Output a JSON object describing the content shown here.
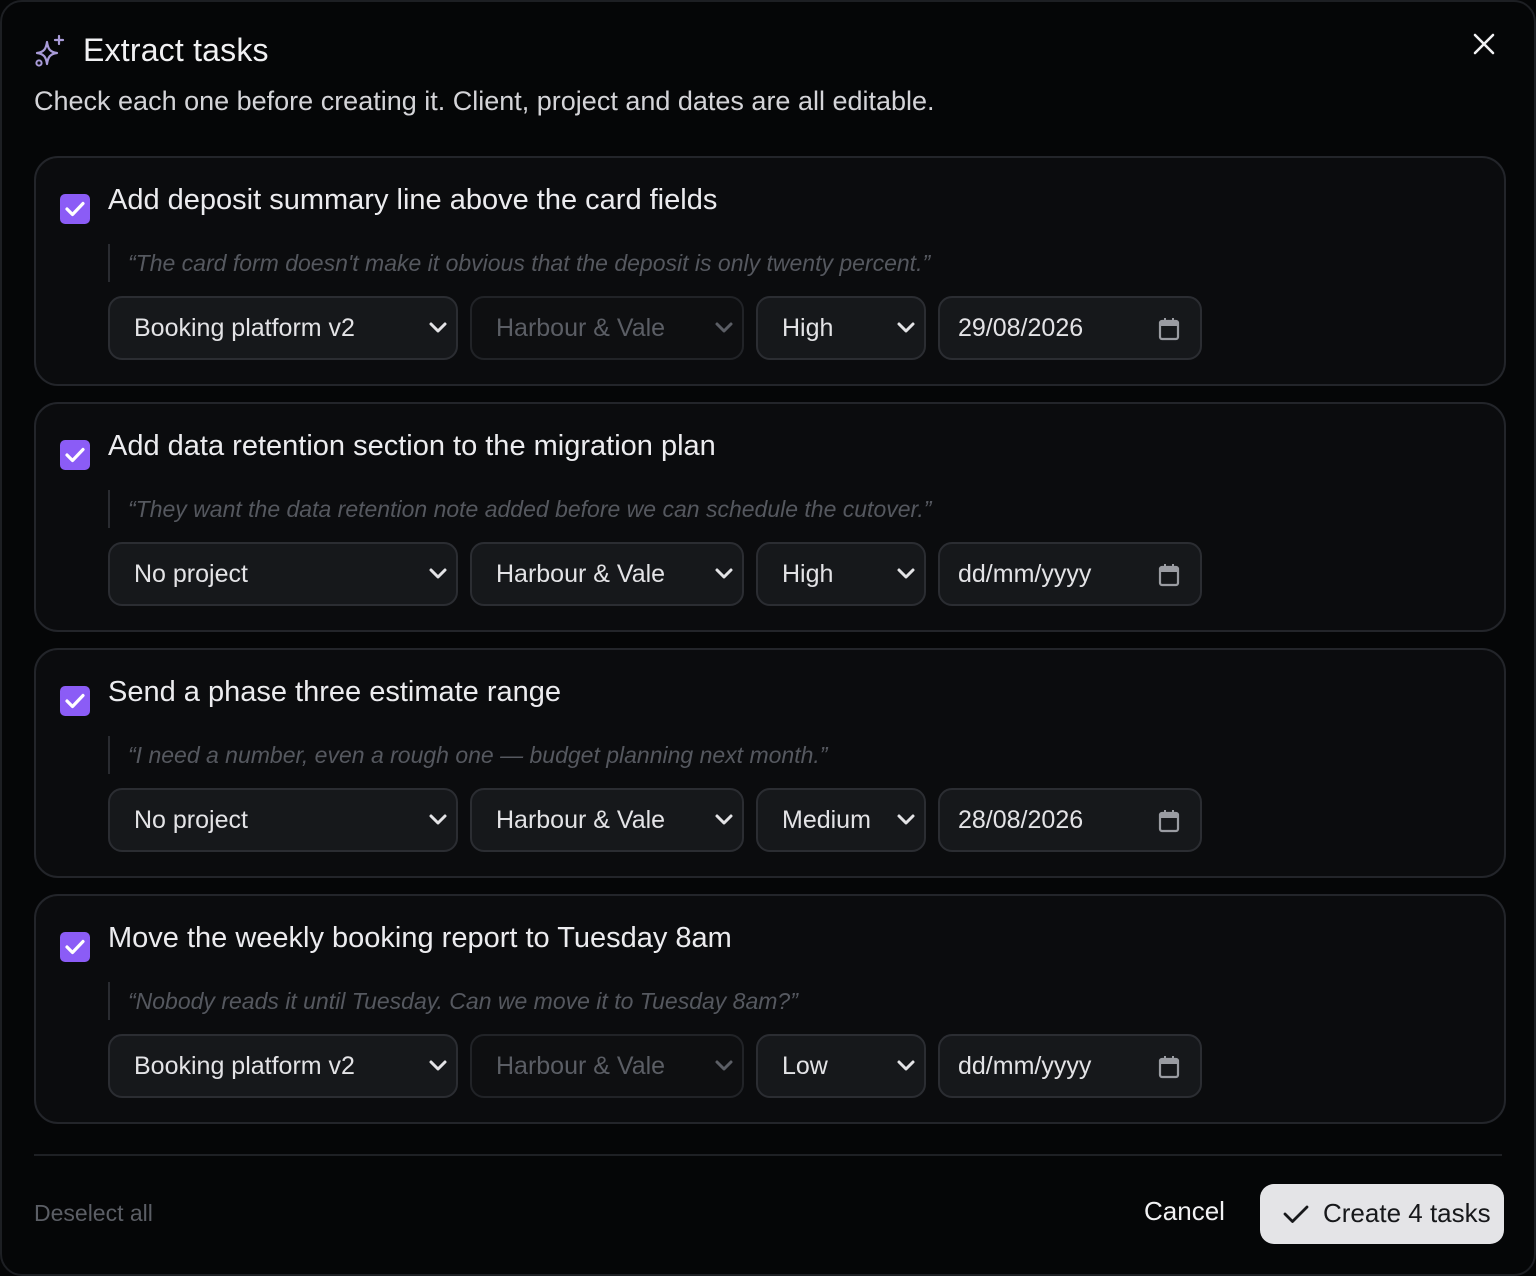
{
  "dialog": {
    "title": "Extract tasks",
    "subtitle": "Check each one before creating it. Client, project and dates are all editable.",
    "icon": "sparkle-icon",
    "accent_color": "#8b5cf6"
  },
  "tasks": [
    {
      "checked": true,
      "title": "Add deposit summary line above the card fields",
      "quote": "“The card form doesn't make it obvious that the deposit is only twenty percent.”",
      "project": "Booking platform v2",
      "client": "Harbour & Vale",
      "client_disabled": true,
      "priority": "High",
      "date": "29/08/2026"
    },
    {
      "checked": true,
      "title": "Add data retention section to the migration plan",
      "quote": "“They want the data retention note added before we can schedule the cutover.”",
      "project": "No project",
      "client": "Harbour & Vale",
      "client_disabled": false,
      "priority": "High",
      "date": "dd/mm/yyyy"
    },
    {
      "checked": true,
      "title": "Send a phase three estimate range",
      "quote": "“I need a number, even a rough one — budget planning next month.”",
      "project": "No project",
      "client": "Harbour & Vale",
      "client_disabled": false,
      "priority": "Medium",
      "date": "28/08/2026"
    },
    {
      "checked": true,
      "title": "Move the weekly booking report to Tuesday 8am",
      "quote": "“Nobody reads it until Tuesday. Can we move it to Tuesday 8am?”",
      "project": "Booking platform v2",
      "client": "Harbour & Vale",
      "client_disabled": true,
      "priority": "Low",
      "date": "dd/mm/yyyy"
    }
  ],
  "footer": {
    "deselect_label": "Deselect all",
    "cancel_label": "Cancel",
    "create_label": "Create 4 tasks"
  }
}
